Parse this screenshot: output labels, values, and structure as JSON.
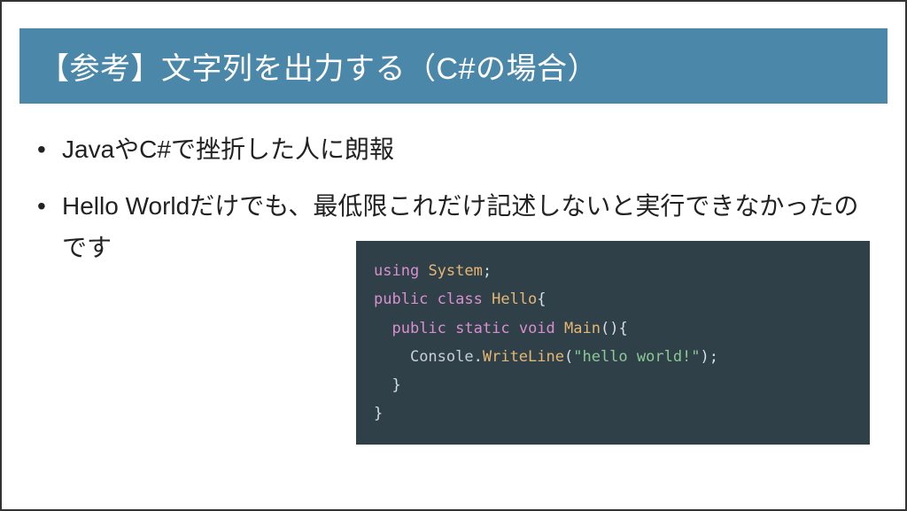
{
  "title": "【参考】文字列を出力する（C#の場合）",
  "bullets": [
    "JavaやC#で挫折した人に朗報",
    "Hello Worldだけでも、最低限これだけ記述しないと実行できなかったのです"
  ],
  "code": {
    "line1": {
      "kw": "using",
      "type": "System",
      "end": ";"
    },
    "blank1": " ",
    "line2": {
      "kw1": "public",
      "kw2": "class",
      "name": "Hello",
      "brace": "{"
    },
    "line3": {
      "indent": "  ",
      "kw1": "public",
      "kw2": "static",
      "kw3": "void",
      "name": "Main",
      "parens": "(){"
    },
    "line4": {
      "indent": "    ",
      "obj": "Console",
      "dot": ".",
      "fn": "WriteLine",
      "open": "(",
      "str": "\"hello world!\"",
      "close": ");"
    },
    "line5": {
      "indent": "  ",
      "brace": "}"
    },
    "line6": {
      "brace": "}"
    }
  }
}
